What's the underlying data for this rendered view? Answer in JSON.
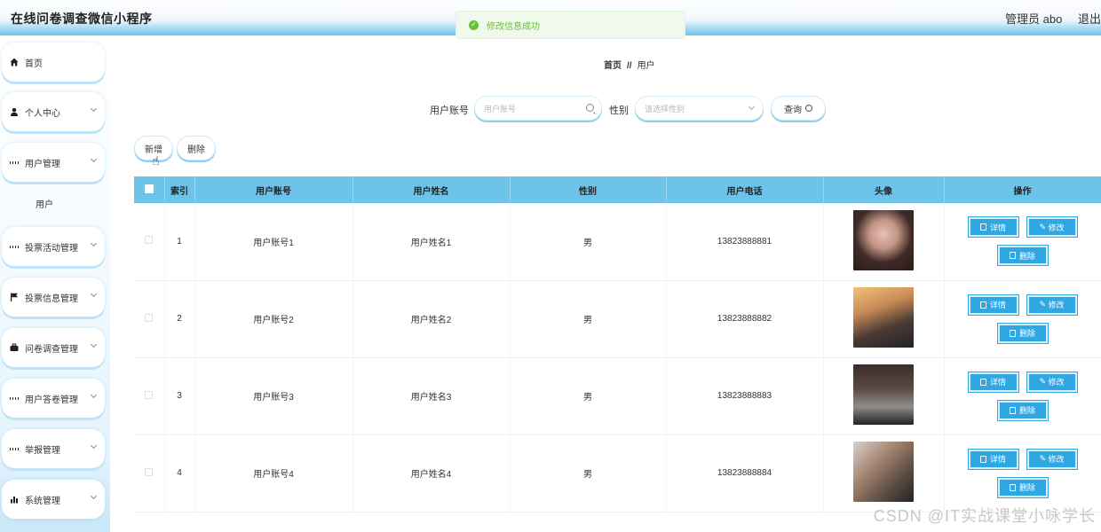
{
  "header": {
    "title": "在线问卷调查微信小程序",
    "admin_label": "管理员 abo",
    "logout_label": "退出"
  },
  "toast": {
    "message": "修改信息成功"
  },
  "sidebar": {
    "items": [
      {
        "label": "首页",
        "icon": "home-icon"
      },
      {
        "label": "个人中心",
        "icon": "user-icon"
      },
      {
        "label": "用户管理",
        "icon": "grid-icon",
        "sub": "用户"
      },
      {
        "label": "投票活动管理",
        "icon": "grid-icon"
      },
      {
        "label": "投票信息管理",
        "icon": "flag-icon"
      },
      {
        "label": "问卷调查管理",
        "icon": "briefcase-icon"
      },
      {
        "label": "用户答卷管理",
        "icon": "grid-icon"
      },
      {
        "label": "举报管理",
        "icon": "grid-icon"
      },
      {
        "label": "系统管理",
        "icon": "bar-chart-icon"
      }
    ]
  },
  "breadcrumb": {
    "home": "首页",
    "sep": "//",
    "current": "用户"
  },
  "search": {
    "account_label": "用户账号",
    "account_placeholder": "用户账号",
    "gender_label": "性别",
    "gender_placeholder": "请选择性别",
    "query_label": "查询"
  },
  "toolbar": {
    "add_label": "新增",
    "delete_label": "删除"
  },
  "table": {
    "headers": [
      "索引",
      "用户账号",
      "用户姓名",
      "性别",
      "用户电话",
      "头像",
      "操作"
    ],
    "rows": [
      {
        "index": "1",
        "account": "用户账号1",
        "name": "用户姓名1",
        "gender": "男",
        "phone": "13823888881"
      },
      {
        "index": "2",
        "account": "用户账号2",
        "name": "用户姓名2",
        "gender": "男",
        "phone": "13823888882"
      },
      {
        "index": "3",
        "account": "用户账号3",
        "name": "用户姓名3",
        "gender": "男",
        "phone": "13823888883"
      },
      {
        "index": "4",
        "account": "用户账号4",
        "name": "用户姓名4",
        "gender": "男",
        "phone": "13823888884"
      }
    ],
    "actions": {
      "detail": "详情",
      "edit": "修改",
      "delete": "删除"
    }
  },
  "watermark": "CSDN @IT实战课堂小咏学长"
}
